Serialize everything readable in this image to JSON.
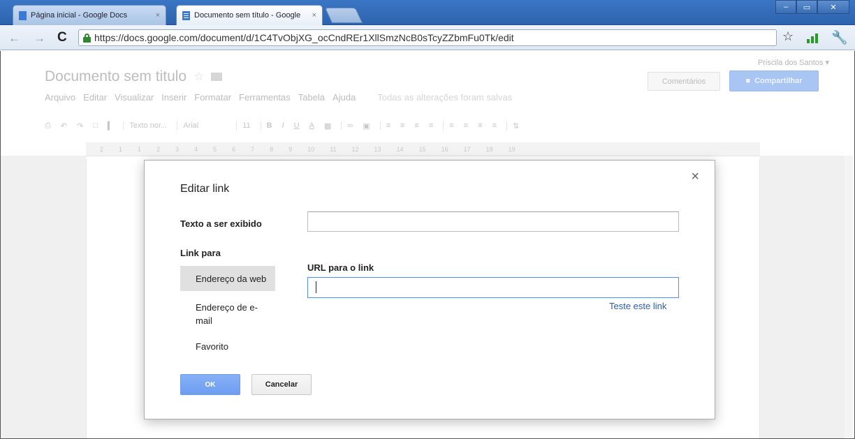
{
  "browser": {
    "tabs": [
      {
        "label": "Página inicial - Google Docs",
        "close": "×"
      },
      {
        "label": "Documento sem título - Google",
        "close": "×"
      }
    ],
    "window_buttons": {
      "minimize": "–",
      "maximize": "▭",
      "close": "✕"
    },
    "nav": {
      "back": "←",
      "forward": "→",
      "reload": "C"
    },
    "url": "https://docs.google.com/document/d/1C4TvObjXG_ocCndREr1XllSmzNcB0sTcyZZbmFu0Tk/edit",
    "icons": {
      "star": "☆",
      "wrench": "🔧"
    }
  },
  "docs": {
    "user": "Priscila dos Santos ▾",
    "title": "Documento sem titulo",
    "star": "☆",
    "menu": [
      "Arquivo",
      "Editar",
      "Visualizar",
      "Inserir",
      "Formatar",
      "Ferramentas",
      "Tabela",
      "Ajuda"
    ],
    "saved_status": "Todas as alterações foram salvas",
    "comments_button": "Comentários",
    "share_button": "Compartilhar",
    "toolbar": {
      "style_select": "Texto nor...",
      "font_select": "Arial",
      "size_select": "11",
      "bold": "B",
      "italic": "I",
      "underline": "U",
      "text_color": "A"
    },
    "ruler_ticks": [
      "2",
      "1",
      "1",
      "2",
      "3",
      "4",
      "5",
      "6",
      "7",
      "8",
      "9",
      "10",
      "11",
      "12",
      "13",
      "14",
      "15",
      "16",
      "17",
      "18",
      "19"
    ]
  },
  "dialog": {
    "title": "Editar link",
    "close": "×",
    "display_text_label": "Texto a ser exibido",
    "display_text_value": "",
    "link_to_label": "Link para",
    "options": [
      "Endereço da web",
      "Endereço de e-mail",
      "Favorito"
    ],
    "selected_option": "Endereço da web",
    "url_label": "URL para o link",
    "url_value": "",
    "test_link": "Teste este link",
    "ok_button": "OK",
    "cancel_button": "Cancelar"
  },
  "colors": {
    "titlebar": "#2d63ae",
    "share_button": "#a9c5f3",
    "ok_button": "#6e9df1",
    "link": "#2a5db0",
    "focus_border": "#4d90fe"
  }
}
